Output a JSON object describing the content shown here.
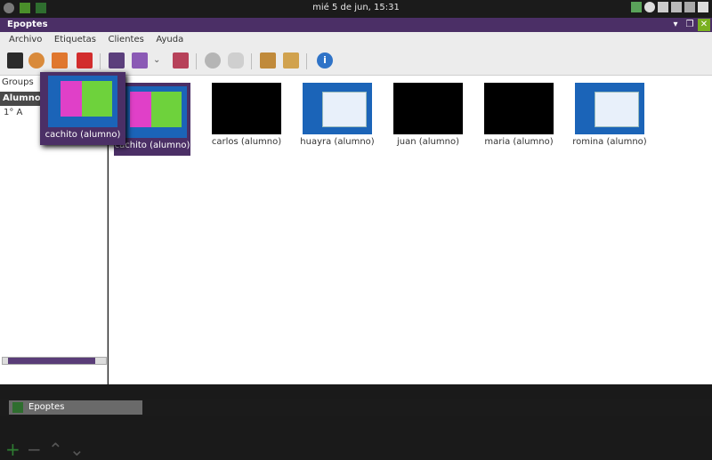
{
  "topbar": {
    "clock": "mié  5 de jun, 15:31"
  },
  "window": {
    "title": "Epoptes"
  },
  "menu": [
    "Archivo",
    "Etiquetas",
    "Clientes",
    "Ayuda"
  ],
  "sidebar": {
    "groups_tab": "Groups",
    "header": "Alumno",
    "rows": [
      "1° A"
    ]
  },
  "clients": [
    {
      "label": "cachito (alumno)",
      "screen": "desktop-pink-green",
      "selected": true
    },
    {
      "label": "carlos (alumno)",
      "screen": "black"
    },
    {
      "label": "huayra (alumno)",
      "screen": "desktop-window"
    },
    {
      "label": "juan (alumno)",
      "screen": "black"
    },
    {
      "label": "maria (alumno)",
      "screen": "black"
    },
    {
      "label": "romina (alumno)",
      "screen": "desktop-window"
    }
  ],
  "hover_preview": {
    "label": "cachito (alumno)"
  },
  "taskbar": {
    "app": "Epoptes"
  },
  "colors": {
    "accent": "#4b2f66",
    "close": "#7ab020"
  }
}
